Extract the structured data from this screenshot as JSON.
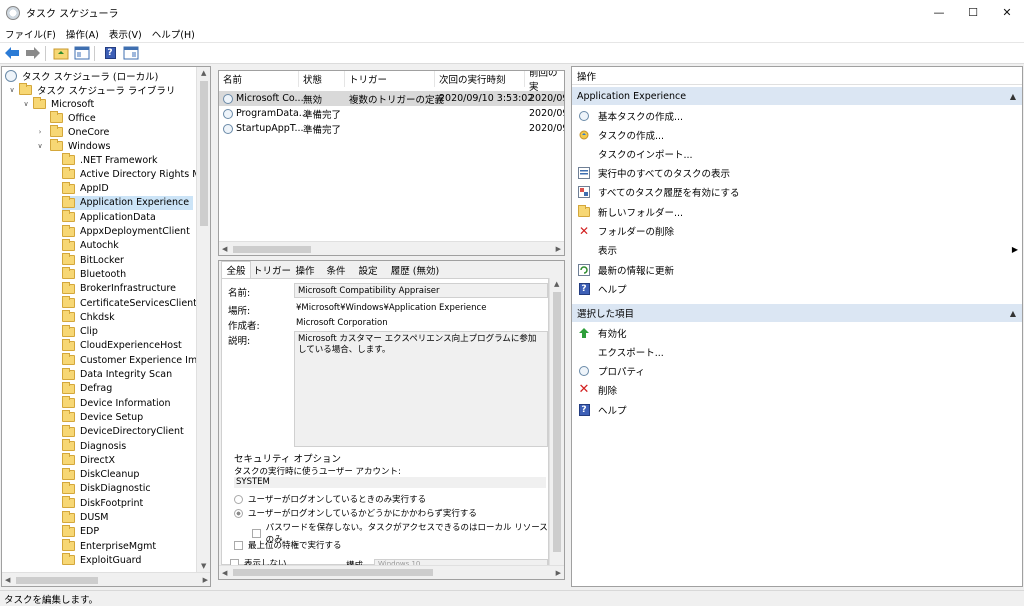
{
  "window": {
    "title": "タスク スケジューラ"
  },
  "menu": [
    "ファイル(F)",
    "操作(A)",
    "表示(V)",
    "ヘルプ(H)"
  ],
  "tree": {
    "root": "タスク スケジューラ (ローカル)",
    "library": "タスク スケジューラ ライブラリ",
    "microsoft": "Microsoft",
    "office": "Office",
    "onecore": "OneCore",
    "windows": "Windows",
    "items": [
      ".NET Framework",
      "Active Directory Rights Manag",
      "AppID",
      "Application Experience",
      "ApplicationData",
      "AppxDeploymentClient",
      "Autochk",
      "BitLocker",
      "Bluetooth",
      "BrokerInfrastructure",
      "CertificateServicesClient",
      "Chkdsk",
      "Clip",
      "CloudExperienceHost",
      "Customer Experience Improv",
      "Data Integrity Scan",
      "Defrag",
      "Device Information",
      "Device Setup",
      "DeviceDirectoryClient",
      "Diagnosis",
      "DirectX",
      "DiskCleanup",
      "DiskDiagnostic",
      "DiskFootprint",
      "DUSM",
      "EDP",
      "EnterpriseMgmt",
      "ExploitGuard"
    ],
    "selected_index": 3
  },
  "task_list": {
    "columns": [
      "名前",
      "状態",
      "トリガー",
      "次回の実行時刻",
      "前回の実"
    ],
    "rows": [
      [
        "Microsoft Co...",
        "無効",
        "複数のトリガーの定義",
        "2020/09/10 3:53:02",
        "2020/09/"
      ],
      [
        "ProgramData...",
        "準備完了",
        "",
        "",
        "2020/09/"
      ],
      [
        "StartupAppT...",
        "準備完了",
        "",
        "",
        "2020/09/"
      ]
    ]
  },
  "detail": {
    "tabs": [
      "全般",
      "トリガー",
      "操作",
      "条件",
      "設定",
      "履歴 (無効)"
    ],
    "name_label": "名前:",
    "name_value": "Microsoft Compatibility Appraiser",
    "location_label": "場所:",
    "location_value": "¥Microsoft¥Windows¥Application Experience",
    "author_label": "作成者:",
    "author_value": "Microsoft Corporation",
    "desc_label": "説明:",
    "desc_value": "Microsoft カスタマー エクスペリエンス向上プログラムに参加している場合、します。",
    "security_title": "セキュリティ オプション",
    "run_as_label": "タスクの実行時に使うユーザー アカウント:",
    "run_as_value": "SYSTEM",
    "opt1": "ユーザーがログオンしているときのみ実行する",
    "opt2": "ユーザーがログオンしているかどうかにかかわらず実行する",
    "opt3": "パスワードを保存しない。タスクがアクセスできるのはローカル リソースのみ",
    "opt4": "最上位の特権で実行する",
    "hidden_label": "表示しない",
    "config_label": "構成",
    "config_value": "Windows 10"
  },
  "actions": {
    "header": "操作",
    "section1": "Application Experience",
    "items1": [
      "基本タスクの作成...",
      "タスクの作成...",
      "タスクのインポート...",
      "実行中のすべてのタスクの表示",
      "すべてのタスク履歴を有効にする",
      "新しいフォルダー...",
      "フォルダーの削除",
      "表示",
      "最新の情報に更新",
      "ヘルプ"
    ],
    "section2": "選択した項目",
    "items2": [
      "有効化",
      "エクスポート...",
      "プロパティ",
      "削除",
      "ヘルプ"
    ]
  },
  "status": "タスクを編集します。"
}
